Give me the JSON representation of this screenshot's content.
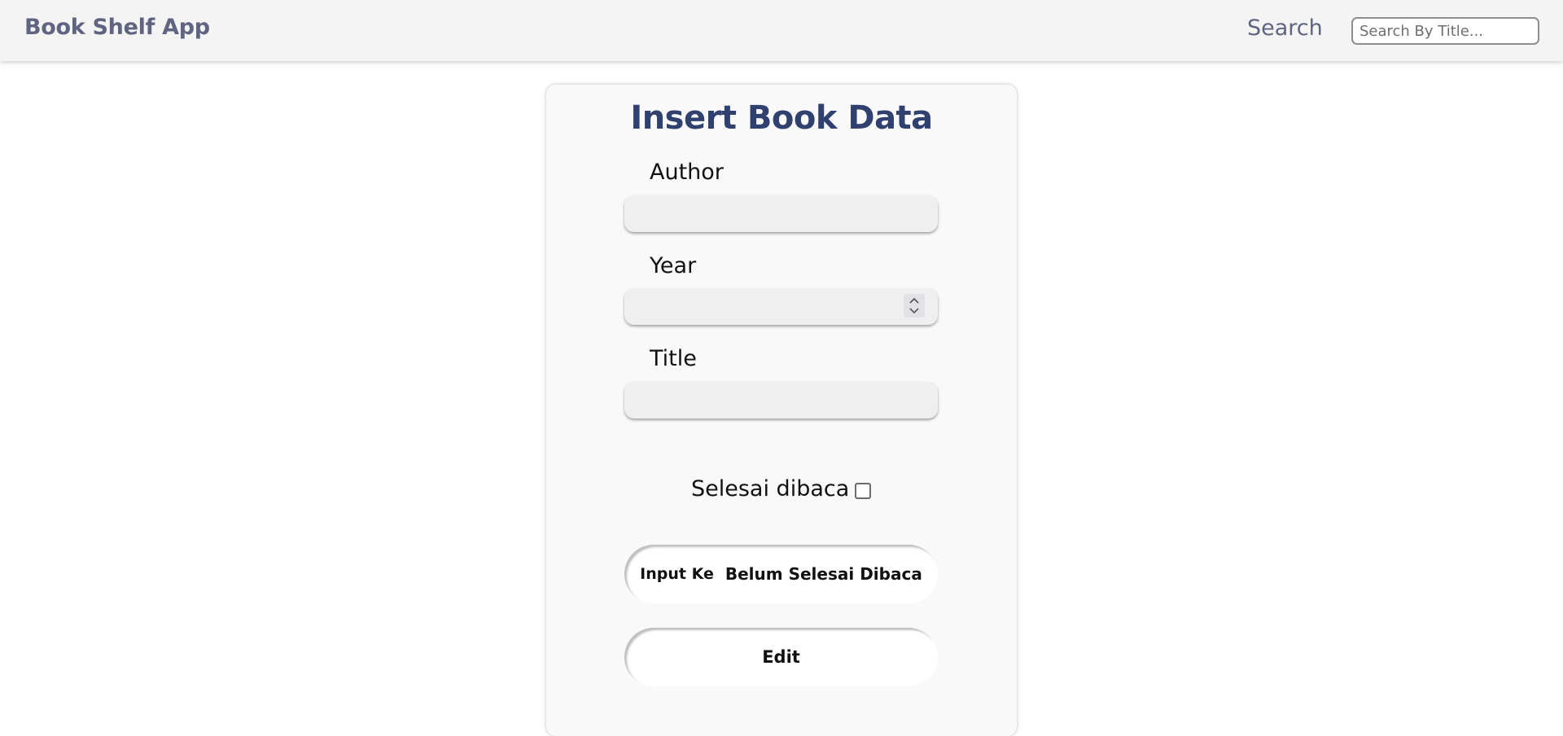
{
  "app": {
    "title": "Book Shelf App"
  },
  "search": {
    "label": "Search",
    "placeholder": "Search By Title..."
  },
  "form": {
    "heading": "Insert Book Data",
    "author": {
      "label": "Author",
      "value": ""
    },
    "year": {
      "label": "Year",
      "value": ""
    },
    "title": {
      "label": "Title",
      "value": ""
    },
    "finished": {
      "label": "Selesai dibaca",
      "checked": false
    },
    "submit": {
      "prefix": "Input Ke",
      "target": "Belum Selesai Dibaca"
    },
    "edit": {
      "label": "Edit"
    }
  },
  "colors": {
    "brand": "#5f6580",
    "heading": "#30416f",
    "navbar": "#f4f4f4",
    "card": "#f9f9f9",
    "input": "#efefef"
  }
}
